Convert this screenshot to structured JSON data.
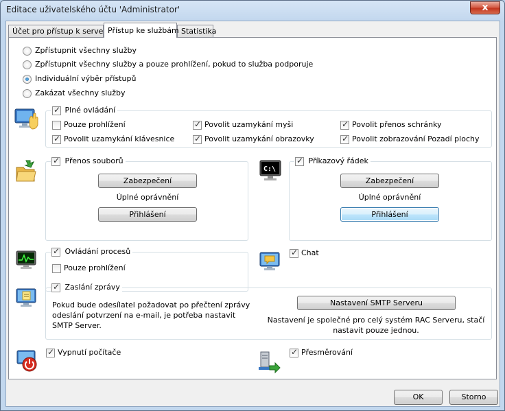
{
  "window": {
    "title": "Editace uživatelského účtu 'Administrator'",
    "close_glyph": "x"
  },
  "tabs": [
    {
      "label": "Účet pro přístup k serveru",
      "active": false
    },
    {
      "label": "Přístup ke službám",
      "active": true
    },
    {
      "label": "Statistika",
      "active": false
    }
  ],
  "access_options": [
    {
      "label": "Zpřístupnit všechny služby",
      "selected": false
    },
    {
      "label": "Zpřístupnit všechny služby a pouze prohlížení, pokud to služba podporuje",
      "selected": false
    },
    {
      "label": "Individuální výběr přístupů",
      "selected": true
    },
    {
      "label": "Zakázat všechny služby",
      "selected": false
    }
  ],
  "full_control": {
    "label": "Plné ovládání",
    "checked": true,
    "icon": "remote-control-icon",
    "options": [
      {
        "label": "Pouze prohlížení",
        "checked": false
      },
      {
        "label": "Povolit uzamykání myši",
        "checked": true
      },
      {
        "label": "Povolit přenos schránky",
        "checked": true
      },
      {
        "label": "Povolit uzamykání klávesnice",
        "checked": true
      },
      {
        "label": "Povolit uzamykání obrazovky",
        "checked": true
      },
      {
        "label": "Povolit zobrazování Pozadí plochy",
        "checked": true
      }
    ]
  },
  "file_transfer": {
    "label": "Přenos souborů",
    "checked": true,
    "icon": "folder-transfer-icon",
    "security_button": "Zabezpečení",
    "permissions_text": "Úplné oprávnění",
    "login_button": "Přihlášení"
  },
  "command_line": {
    "label": "Příkazový řádek",
    "checked": true,
    "icon": "command-prompt-icon",
    "icon_text": "C:\\",
    "security_button": "Zabezpečení",
    "permissions_text": "Úplné oprávnění",
    "login_button": "Přihlášení"
  },
  "process_control": {
    "label": "Ovládání procesů",
    "checked": true,
    "icon": "process-monitor-icon",
    "view_only": {
      "label": "Pouze prohlížení",
      "checked": false
    }
  },
  "chat": {
    "label": "Chat",
    "checked": true,
    "icon": "chat-icon"
  },
  "message": {
    "label": "Zaslání zprávy",
    "checked": true,
    "icon": "message-icon",
    "info": "Pokud bude odesílatel požadovat po přečtení zprávy odeslání potvrzení na e-mail, je potřeba nastavit SMTP Server.",
    "smtp_button": "Nastavení SMTP Serveru",
    "note": "Nastavení je společné pro celý systém RAC Serveru, stačí nastavit pouze jednou."
  },
  "shutdown": {
    "label": "Vypnutí počítače",
    "checked": true,
    "icon": "power-icon"
  },
  "redirect": {
    "label": "Přesměrování",
    "checked": true,
    "icon": "redirect-icon"
  },
  "footer": {
    "ok": "OK",
    "cancel": "Storno"
  }
}
